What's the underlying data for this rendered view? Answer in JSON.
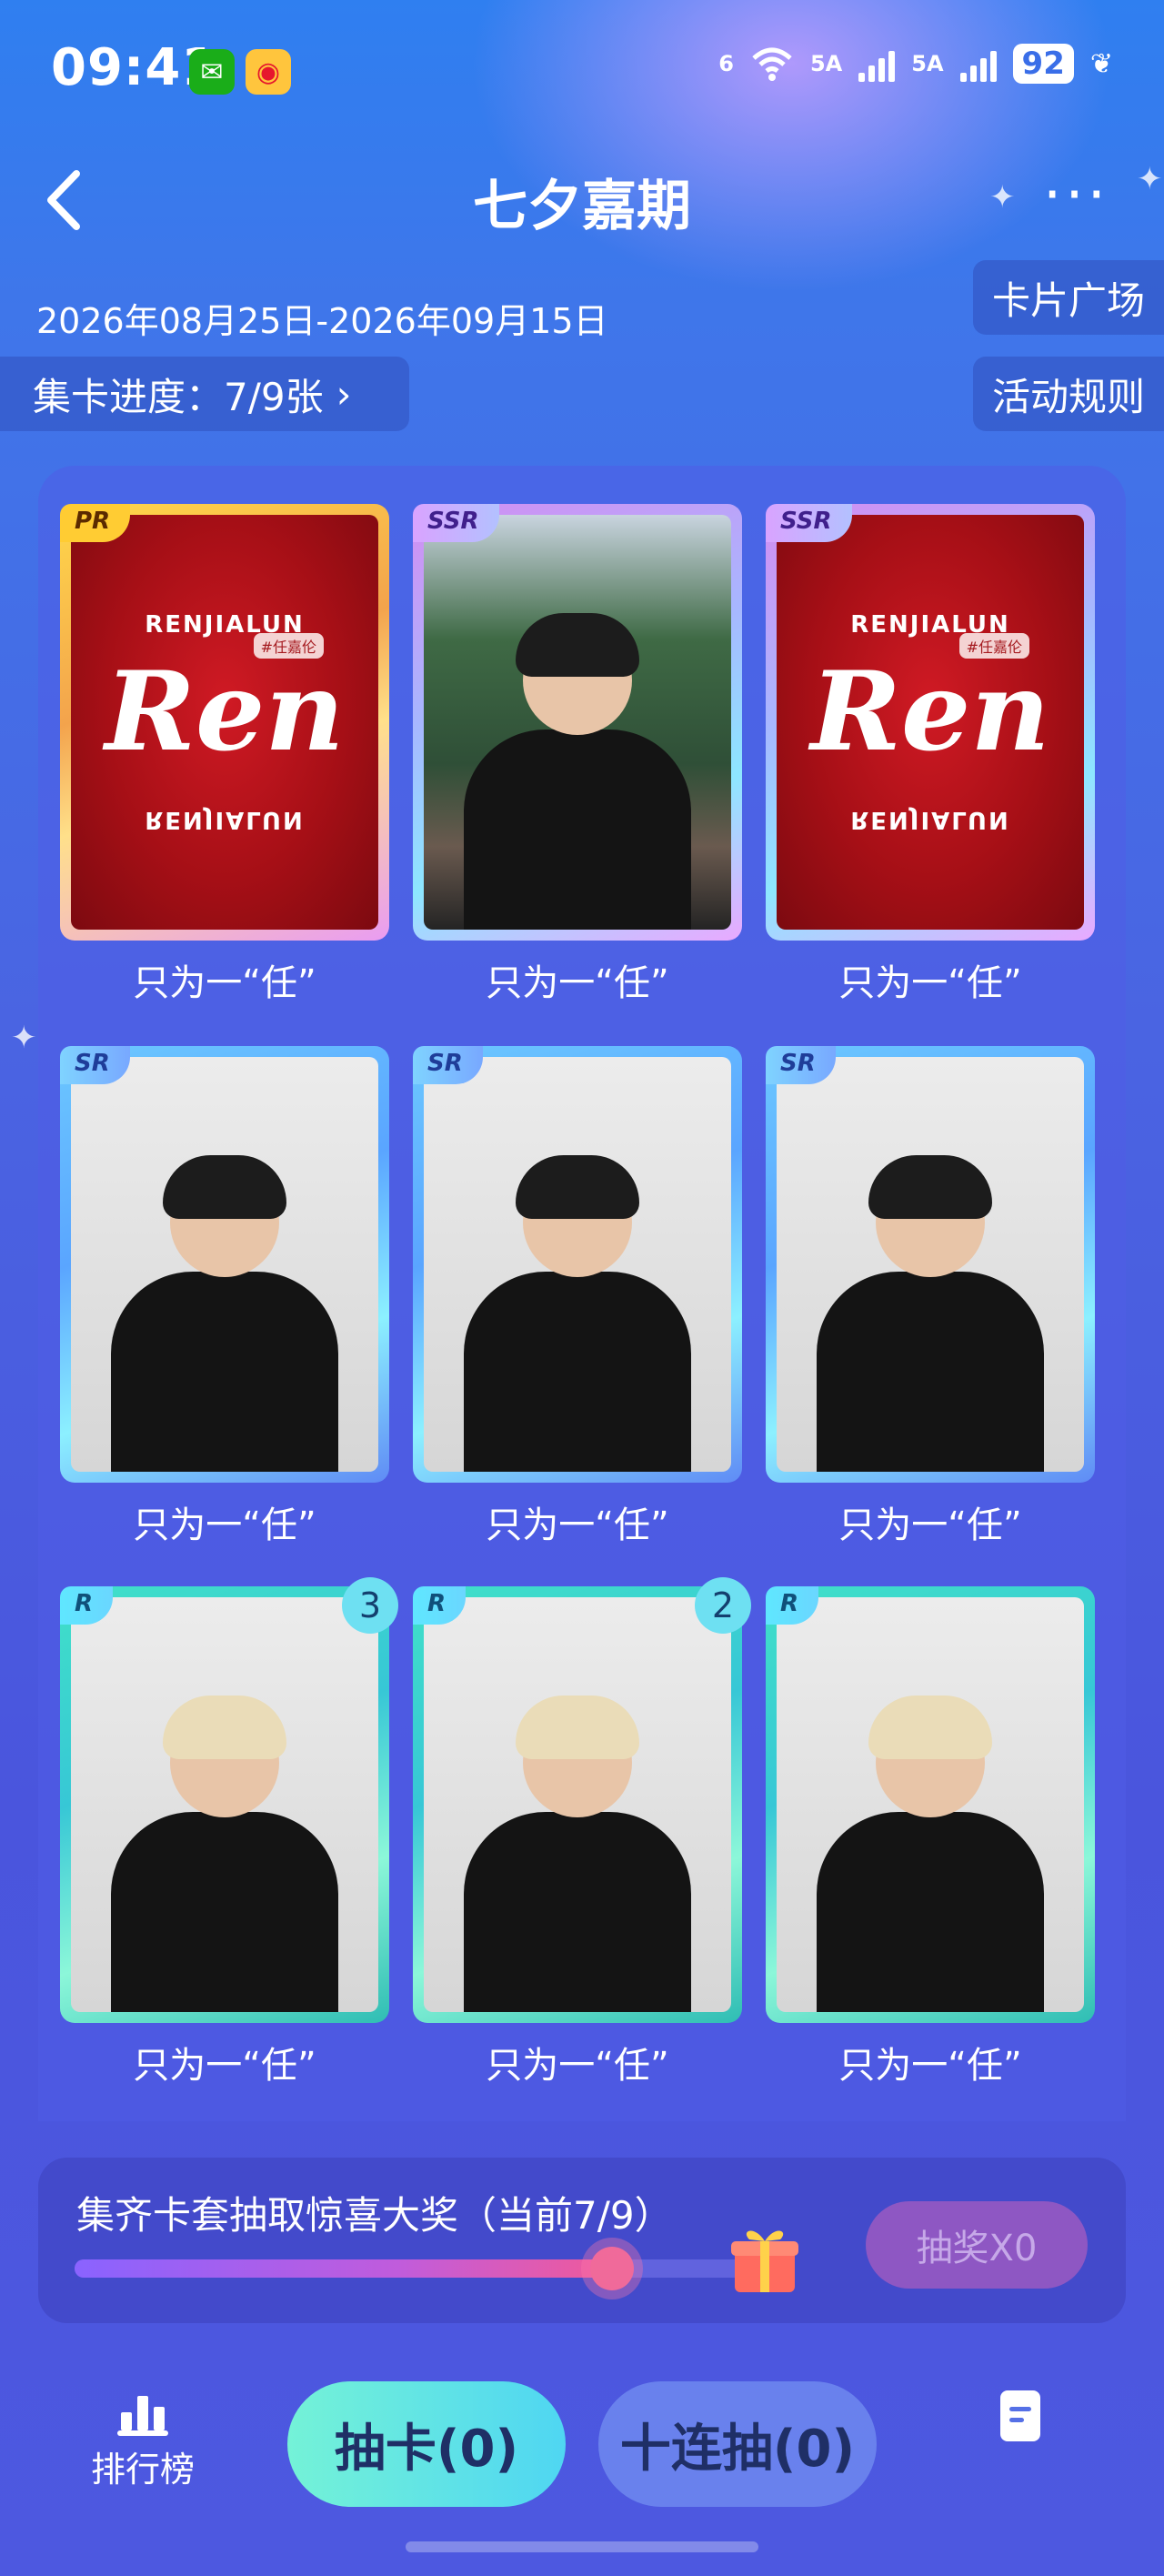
{
  "status_bar": {
    "time": "09:41",
    "network_label_1": "6",
    "network_label_2": "5A",
    "network_label_3": "5A",
    "battery": "92"
  },
  "header": {
    "title": "七夕嘉期",
    "date_range": "2026年08月25日-2026年09月15日",
    "progress_label": "集卡进度：7/9张",
    "card_plaza": "卡片广场",
    "rules": "活动规则"
  },
  "cards": [
    {
      "name": "只为一“任”",
      "rarity": "PR",
      "art": "brand"
    },
    {
      "name": "只为一“任”",
      "rarity": "SSR",
      "art": "landscape"
    },
    {
      "name": "只为一“任”",
      "rarity": "SSR",
      "art": "brand"
    },
    {
      "name": "只为一“任”",
      "rarity": "SR",
      "art": "photo"
    },
    {
      "name": "只为一“任”",
      "rarity": "SR",
      "art": "photo"
    },
    {
      "name": "只为一“任”",
      "rarity": "SR",
      "art": "photo"
    },
    {
      "name": "只为一“任”",
      "rarity": "R",
      "art": "photo",
      "badge": "3"
    },
    {
      "name": "只为一“任”",
      "rarity": "R",
      "art": "photo",
      "badge": "2"
    },
    {
      "name": "只为一“任”",
      "rarity": "R",
      "art": "photo"
    }
  ],
  "card_art": {
    "brand_top": "RENJIALUN",
    "brand_script": "Ren",
    "brand_tag": "#任嘉伦"
  },
  "reward": {
    "title": "集齐卡套抽取惊喜大奖（当前7/9）",
    "progress_fraction": 0.778,
    "button_label": "抽奖X0"
  },
  "bottom": {
    "rank_label": "排行榜",
    "draw_label": "抽卡(0)",
    "ten_draw_label": "十连抽(0)"
  },
  "colors": {
    "accent_mint": "#74f2d7",
    "lottery_disabled": "#8e57c3"
  }
}
